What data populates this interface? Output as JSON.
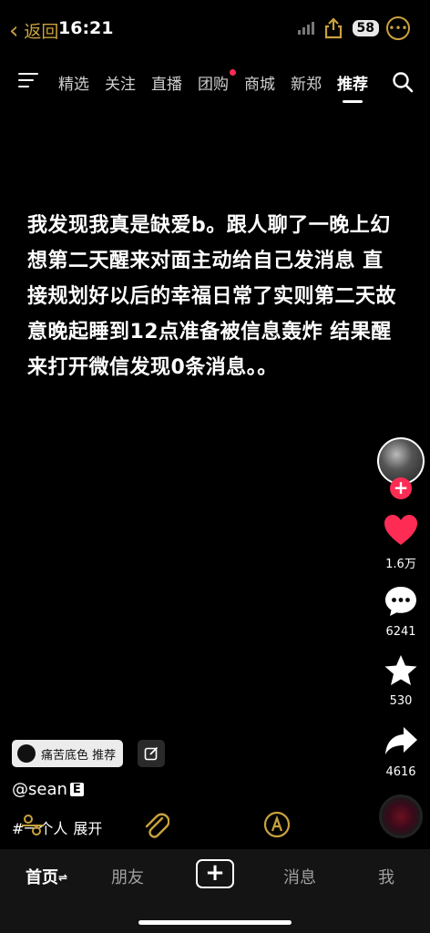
{
  "status": {
    "back_label": "返回",
    "time": "16:21",
    "battery": "58"
  },
  "topnav": {
    "tabs": [
      "精选",
      "关注",
      "直播",
      "团购",
      "商城",
      "新郑",
      "推荐"
    ],
    "active_tab": "推荐",
    "notify_tab": "团购"
  },
  "post": {
    "text": "我发现我真是缺爱b。跟人聊了一晚上幻想第二天醒来对面主动给自己发消息 直接规划好以后的幸福日常了实则第二天故意晚起睡到12点准备被信息轰炸 结果醒来打开微信发现0条消息。。",
    "tag_chip": "痛苦底色  推荐",
    "username": "@sean",
    "user_badge": "E",
    "hashtag": "#一个人",
    "expand": "展开"
  },
  "rail": {
    "likes": "1.6万",
    "comments": "6241",
    "favorites": "530",
    "shares": "4616"
  },
  "bottom_nav": {
    "home": "首页",
    "friends": "朋友",
    "messages": "消息",
    "me": "我"
  },
  "colors": {
    "accent_gold": "#c9a23e",
    "like_red": "#fe2c55"
  }
}
